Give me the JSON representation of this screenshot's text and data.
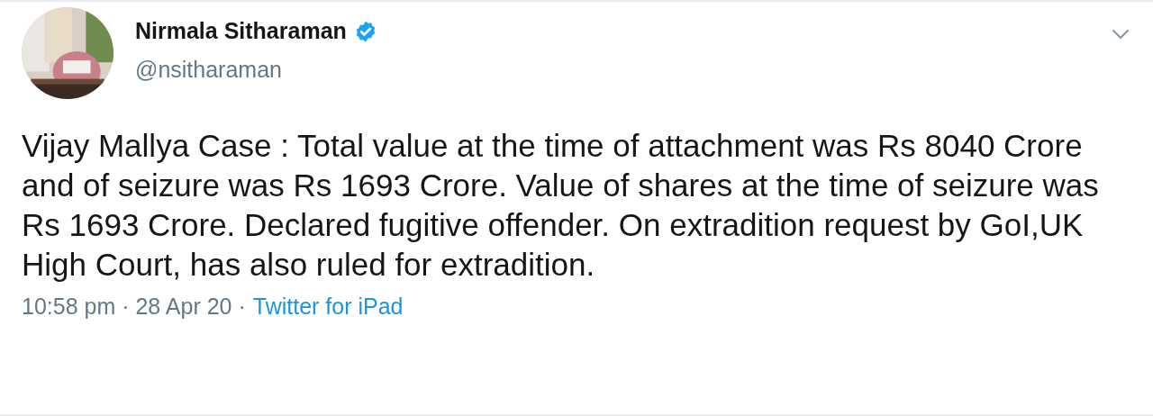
{
  "tweet": {
    "author": {
      "name": "Nirmala Sitharaman",
      "verified": true,
      "handle": "@nsitharaman"
    },
    "text": "Vijay Mallya Case : Total value at the time of attachment was Rs 8040 Crore and of seizure was Rs 1693 Crore. Value of shares at the time of seizure was Rs 1693 Crore. Declared fugitive offender. On extradition request by GoI,UK High Court, has also ruled for extradition.",
    "timestamp": "10:58 pm · 28 Apr 20 ·",
    "source": "Twitter for iPad"
  }
}
